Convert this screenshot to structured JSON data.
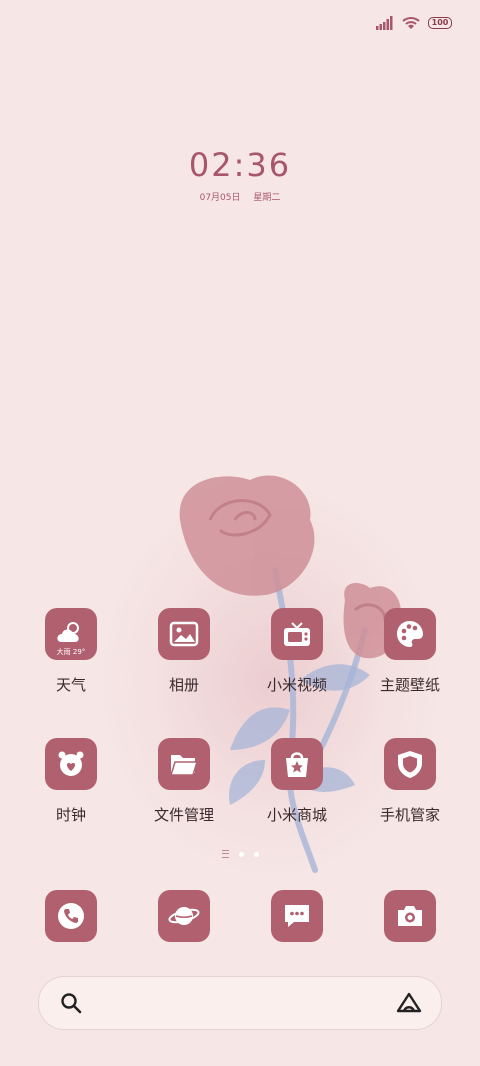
{
  "status": {
    "battery": "100"
  },
  "clock": {
    "time": "02:36",
    "date": "07月05日",
    "weekday": "星期二"
  },
  "apps": [
    {
      "label": "天气",
      "icon": "weather-cloud-icon",
      "sub": "大雨 29°"
    },
    {
      "label": "相册",
      "icon": "gallery-icon"
    },
    {
      "label": "小米视频",
      "icon": "tv-icon"
    },
    {
      "label": "主题壁纸",
      "icon": "palette-icon"
    },
    {
      "label": "时钟",
      "icon": "alarm-clock-icon"
    },
    {
      "label": "文件管理",
      "icon": "folder-icon"
    },
    {
      "label": "小米商城",
      "icon": "shopping-bag-icon"
    },
    {
      "label": "手机管家",
      "icon": "shield-icon"
    }
  ],
  "dock": [
    {
      "icon": "phone-icon"
    },
    {
      "icon": "planet-icon"
    },
    {
      "icon": "message-icon"
    },
    {
      "icon": "camera-icon"
    }
  ],
  "colors": {
    "background": "#f6e7e6",
    "icon_bg": "#b0606e",
    "accent": "#a8566a"
  }
}
